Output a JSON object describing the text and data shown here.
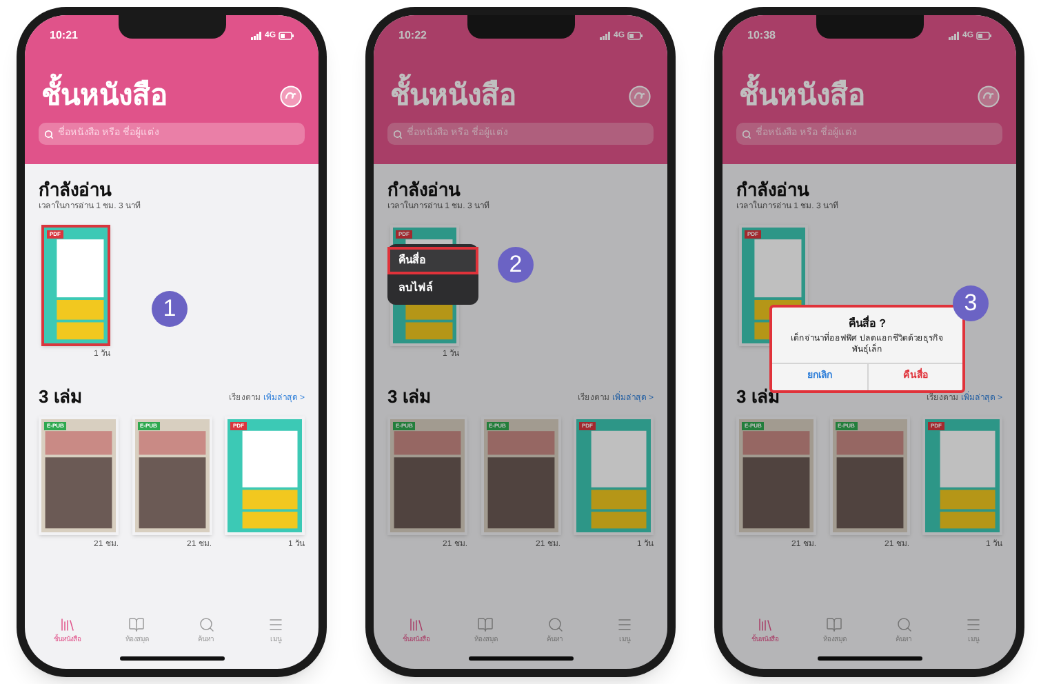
{
  "phones": [
    {
      "step": "1",
      "dimmed": false,
      "status": {
        "time": "10:21",
        "network": "4G"
      },
      "title": "ชั้นหนังสือ",
      "search": {
        "placeholder": "ชื่อหนังสือ หรือ ชื่อผู้แต่ง"
      },
      "reading": {
        "heading": "กำลังอ่าน",
        "subtitle": "เวลาในการอ่าน 1 ชม. 3 นาที",
        "book": {
          "kind": "pattern",
          "badge": {
            "text": "PDF",
            "kind": "pdf"
          },
          "caption": "1 วัน",
          "highlighted": true
        }
      },
      "library": {
        "count": "3 เล่ม",
        "sort_label": "เรียงตาม",
        "sort_value": "เพิ่มล่าสุด >",
        "books": [
          {
            "kind": "illustration",
            "badge": {
              "text": "E-PUB",
              "kind": "epub"
            },
            "caption": "21 ชม."
          },
          {
            "kind": "illustration",
            "badge": {
              "text": "E-PUB",
              "kind": "epub"
            },
            "caption": "21 ชม."
          },
          {
            "kind": "pattern",
            "badge": {
              "text": "PDF",
              "kind": "pdf"
            },
            "caption": "1 วัน"
          }
        ]
      },
      "tabs": [
        {
          "label": "ชั้นหนังสือ",
          "selected": true
        },
        {
          "label": "ห้องสมุด",
          "selected": false
        },
        {
          "label": "ค้นหา",
          "selected": false
        },
        {
          "label": "เมนู",
          "selected": false
        }
      ]
    },
    {
      "step": "2",
      "dimmed": true,
      "status": {
        "time": "10:22",
        "network": "4G"
      },
      "title": "ชั้นหนังสือ",
      "search": {
        "placeholder": "ชื่อหนังสือ หรือ ชื่อผู้แต่ง"
      },
      "reading": {
        "heading": "กำลังอ่าน",
        "subtitle": "เวลาในการอ่าน 1 ชม. 3 นาที",
        "book": {
          "kind": "pattern",
          "badge": {
            "text": "PDF",
            "kind": "pdf"
          },
          "caption": "1 วัน"
        }
      },
      "menu": {
        "items": [
          {
            "label": "คืนสื่อ",
            "highlighted": true
          },
          {
            "label": "ลบไฟล์",
            "highlighted": false
          }
        ]
      },
      "library": {
        "count": "3 เล่ม",
        "sort_label": "เรียงตาม",
        "sort_value": "เพิ่มล่าสุด >",
        "books": [
          {
            "kind": "illustration",
            "badge": {
              "text": "E-PUB",
              "kind": "epub"
            },
            "caption": "21 ชม."
          },
          {
            "kind": "illustration",
            "badge": {
              "text": "E-PUB",
              "kind": "epub"
            },
            "caption": "21 ชม."
          },
          {
            "kind": "pattern",
            "badge": {
              "text": "PDF",
              "kind": "pdf"
            },
            "caption": "1 วัน"
          }
        ]
      },
      "tabs": [
        {
          "label": "ชั้นหนังสือ",
          "selected": true
        },
        {
          "label": "ห้องสมุด",
          "selected": false
        },
        {
          "label": "ค้นหา",
          "selected": false
        },
        {
          "label": "เมนู",
          "selected": false
        }
      ]
    },
    {
      "step": "3",
      "dimmed": true,
      "status": {
        "time": "10:38",
        "network": "4G"
      },
      "title": "ชั้นหนังสือ",
      "search": {
        "placeholder": "ชื่อหนังสือ หรือ ชื่อผู้แต่ง"
      },
      "reading": {
        "heading": "กำลังอ่าน",
        "subtitle": "เวลาในการอ่าน 1 ชม. 3 นาที",
        "book": {
          "kind": "pattern",
          "badge": {
            "text": "PDF",
            "kind": "pdf"
          }
        }
      },
      "dialog": {
        "title": "คืนสื่อ ?",
        "message": "เด็กจ่านาที่ออฟฟิศ ปลดแอกชีวิตด้วยธุรกิจพันธุ์เล็ก",
        "highlighted": true,
        "buttons": [
          {
            "label": "ยกเลิก",
            "kind": "cancel"
          },
          {
            "label": "คืนสื่อ",
            "kind": "destructive"
          }
        ]
      },
      "library": {
        "count": "3 เล่ม",
        "sort_label": "เรียงตาม",
        "sort_value": "เพิ่มล่าสุด >",
        "books": [
          {
            "kind": "illustration",
            "badge": {
              "text": "E-PUB",
              "kind": "epub"
            },
            "caption": "21 ชม."
          },
          {
            "kind": "illustration",
            "badge": {
              "text": "E-PUB",
              "kind": "epub"
            },
            "caption": "21 ชม."
          },
          {
            "kind": "pattern",
            "badge": {
              "text": "PDF",
              "kind": "pdf"
            },
            "caption": "1 วัน"
          }
        ]
      },
      "tabs": [
        {
          "label": "ชั้นหนังสือ",
          "selected": true
        },
        {
          "label": "ห้องสมุด",
          "selected": false
        },
        {
          "label": "ค้นหา",
          "selected": false
        },
        {
          "label": "เมนู",
          "selected": false
        }
      ]
    }
  ]
}
